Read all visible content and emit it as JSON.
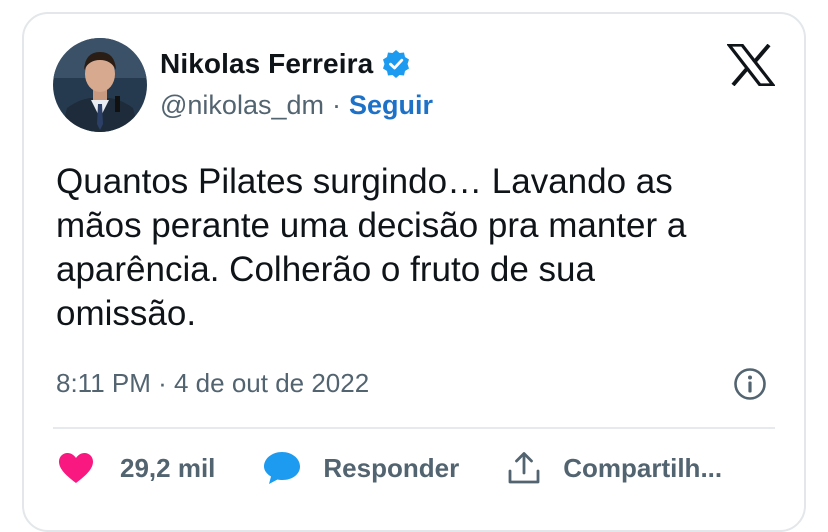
{
  "author": {
    "name": "Nikolas Ferreira",
    "handle": "@nikolas_dm",
    "separator": "·",
    "follow_label": "Seguir"
  },
  "tweet": {
    "text": "Quantos Pilates surgindo… Lavando as\nmãos perante uma decisão pra manter a\naparência. Colherão o fruto de sua\nomissão.",
    "timestamp": "8:11 PM · 4 de out de 2022"
  },
  "actions": {
    "like_count": "29,2 mil",
    "reply_label": "Responder",
    "share_label": "Compartilh..."
  },
  "icons": [
    "verified-badge-icon",
    "x-logo-icon",
    "info-icon",
    "heart-icon",
    "reply-bubble-icon",
    "share-icon"
  ],
  "colors": {
    "verified": "#1d9bf0",
    "follow": "#1d72c8",
    "heart": "#f91880",
    "reply": "#1d9bf0",
    "secondary_text": "#536471"
  }
}
